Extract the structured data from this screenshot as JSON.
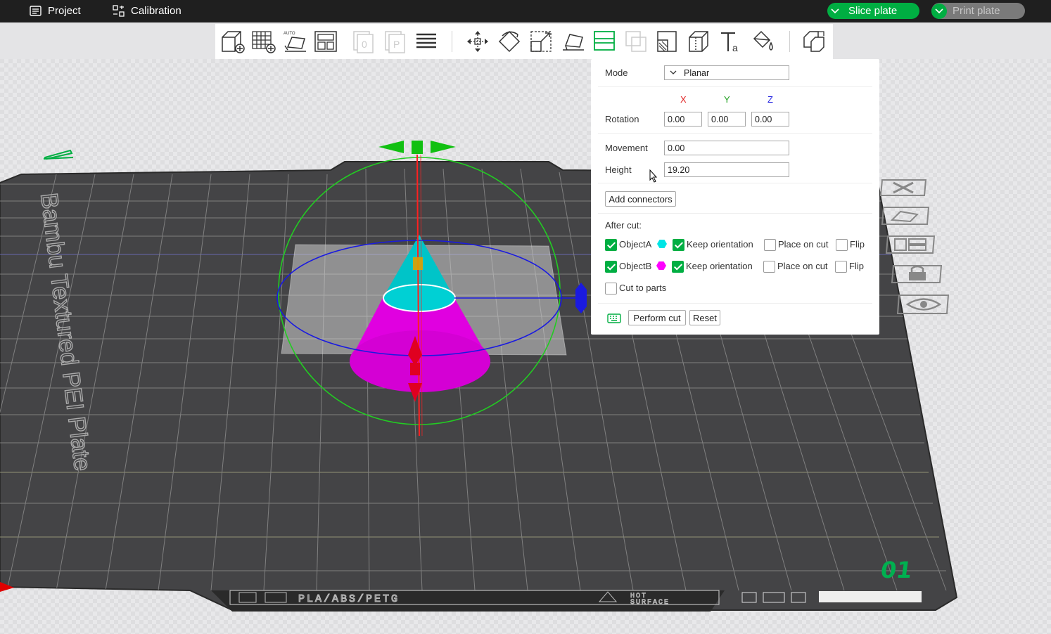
{
  "topbar": {
    "project_label": "Project",
    "calibration_label": "Calibration",
    "slice_label": "Slice plate",
    "print_label": "Print plate",
    "colors": {
      "bar": "#1f1f1f",
      "accent": "#00ae42"
    }
  },
  "toolbar": {
    "icons": [
      "add-object-icon",
      "add-plate-icon",
      "auto-orient-icon",
      "arrange-icon",
      "clone-icon",
      "plate-icon",
      "layers-icon",
      "move-icon",
      "rotate-icon",
      "scale-icon",
      "lay-on-face-icon",
      "cut-icon",
      "boolean-icon",
      "support-paint-icon",
      "seam-paint-icon",
      "text-icon",
      "color-paint-icon",
      "assembly-icon"
    ]
  },
  "cut_panel": {
    "mode_label": "Mode",
    "mode_value": "Planar",
    "axis_x": "X",
    "axis_y": "Y",
    "axis_z": "Z",
    "rotation_label": "Rotation",
    "rotation_x": "0.00",
    "rotation_y": "0.00",
    "rotation_z": "0.00",
    "movement_label": "Movement",
    "movement_value": "0.00",
    "height_label": "Height",
    "height_value": "19.20",
    "add_connectors_label": "Add connectors",
    "after_cut_label": "After cut:",
    "object_a_label": "ObjectA",
    "object_b_label": "ObjectB",
    "keep_orientation_label": "Keep orientation",
    "place_on_cut_label": "Place on cut",
    "flip_label": "Flip",
    "cut_to_parts_label": "Cut to parts",
    "perform_cut_label": "Perform cut",
    "reset_label": "Reset",
    "object_a_color": "#00e5e5",
    "object_b_color": "#ff00ff",
    "object_a_checked": true,
    "object_a_keep_orientation": true,
    "object_a_place_on_cut": false,
    "object_a_flip": false,
    "object_b_checked": true,
    "object_b_keep_orientation": true,
    "object_b_place_on_cut": false,
    "object_b_flip": false,
    "cut_to_parts": false
  },
  "bed": {
    "plate_name": "Bambu Textured PEI Plate",
    "filament_text": "PLA/ABS/PETG",
    "hot_text_1": "HOT",
    "hot_text_2": "SURFACE",
    "plate_number": "01"
  }
}
